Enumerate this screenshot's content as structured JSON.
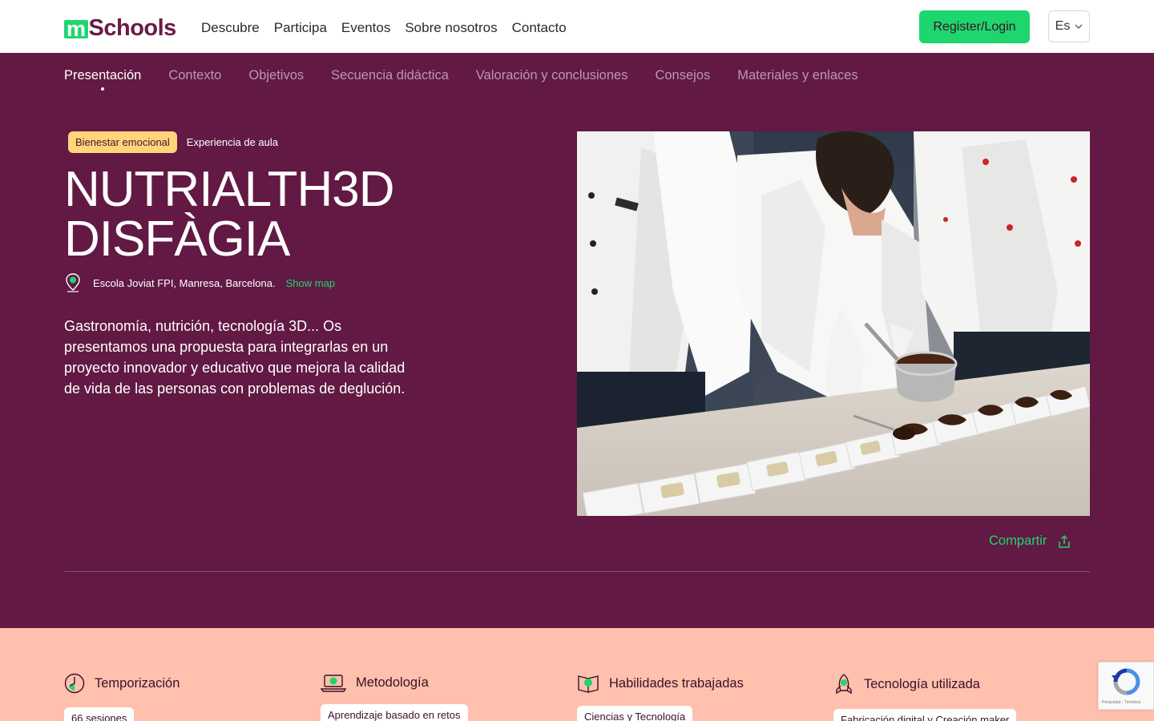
{
  "header": {
    "logo_m": "m",
    "logo_rest": "Schools",
    "nav": [
      "Descubre",
      "Participa",
      "Eventos",
      "Sobre nosotros",
      "Contacto"
    ],
    "register_label": "Register/Login",
    "language": "Es"
  },
  "subnav": {
    "items": [
      "Presentación",
      "Contexto",
      "Objetivos",
      "Secuencia didáctica",
      "Valoración y conclusiones",
      "Consejos",
      "Materiales y enlaces"
    ],
    "active": "Presentación"
  },
  "hero": {
    "tags": [
      "Bienestar emocional",
      "Experiencia de aula"
    ],
    "title_line1": "NUTRIALTH3D",
    "title_line2": "DISFÀGIA",
    "location": "Escola Joviat FPI, Manresa, Barcelona.",
    "show_map": "Show map",
    "description": "Gastronomía, nutrición, tecnología 3D... Os presentamos una propuesta para integrarlas en un proyecto innovador y educativo que mejora la calidad de vida de las personas con problemas de deglución.",
    "share_label": "Compartir"
  },
  "info": {
    "timing": {
      "label": "Temporización",
      "chip": "66 sesiones"
    },
    "method": {
      "label": "Metodología",
      "chip": "Aprendizaje basado en retos"
    },
    "skills": {
      "label": "Habilidades trabajadas",
      "chip": "Ciencias y Tecnología"
    },
    "tech": {
      "label": "Tecnología utilizada",
      "chip": "Fabricación digital y Creación maker"
    }
  },
  "recaptcha": {
    "text": "Privacidad - Términos"
  },
  "colors": {
    "brand_purple": "#621943",
    "accent_green": "#1ed66e",
    "tag_yellow": "#ffd47a",
    "info_band": "#ffc0ad"
  }
}
